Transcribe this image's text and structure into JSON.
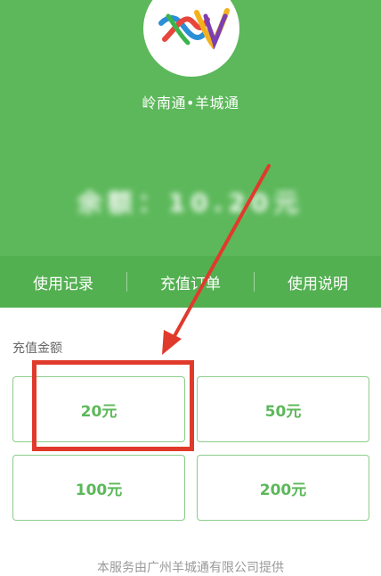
{
  "header": {
    "app_name": "岭南通•羊城通",
    "balance_text": "余额：10.20元"
  },
  "nav": {
    "items": [
      {
        "label": "使用记录"
      },
      {
        "label": "充值订单"
      },
      {
        "label": "使用说明"
      }
    ]
  },
  "recharge": {
    "section_label": "充值金额",
    "amounts": [
      "20元",
      "50元",
      "100元",
      "200元"
    ]
  },
  "footer": {
    "note": "本服务由广州羊城通有限公司提供"
  },
  "colors": {
    "primary_green": "#5cb85a",
    "annotation_red": "#e03a2c"
  }
}
